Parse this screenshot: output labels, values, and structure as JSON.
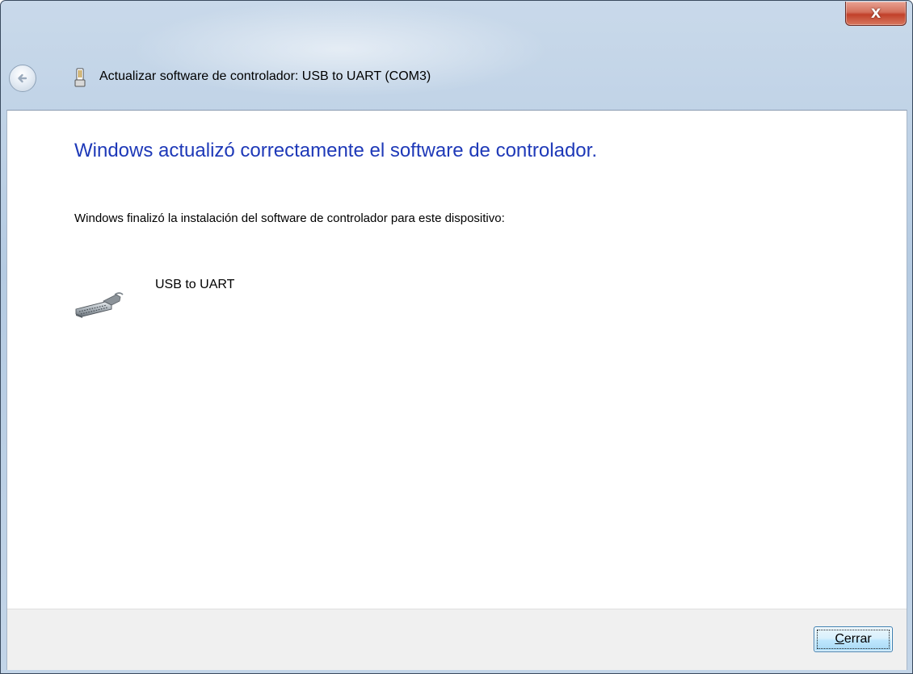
{
  "window": {
    "title": "Actualizar software de controlador: USB to UART (COM3)",
    "close_glyph": "X"
  },
  "content": {
    "heading": "Windows actualizó correctamente el software de controlador.",
    "description": "Windows finalizó la instalación del software de controlador para este dispositivo:",
    "device": {
      "name": "USB to UART",
      "icon": "serial-port-connector-icon"
    }
  },
  "footer": {
    "close_button": {
      "mnemonic": "C",
      "label_rest": "errar"
    }
  },
  "colors": {
    "heading": "#1e39b8",
    "frame": "#b9cde3",
    "footer": "#f0f0f0"
  }
}
